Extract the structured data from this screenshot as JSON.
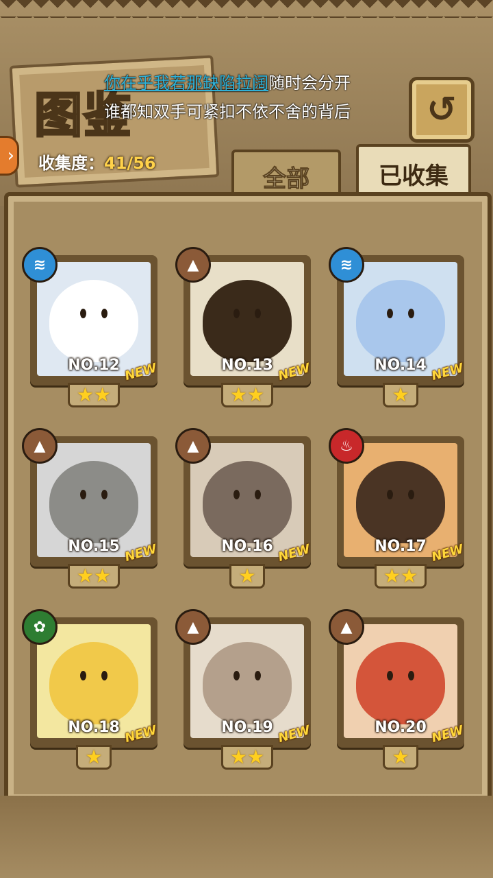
{
  "header": {
    "title": "图鉴",
    "lyric_highlight": "你在乎我若那缺陷拉阔",
    "lyric_rest": "随时会分开",
    "lyric_line2": "谁都知双手可紧扣不依不舍的背后",
    "collect_label": "收集度：",
    "collect_value": "41/56",
    "back_icon": "↺"
  },
  "tabs": {
    "all_label": "全部",
    "collected_label": "已收集"
  },
  "colors": {
    "water": "#2f8fd6",
    "earth": "#8b5a38",
    "fire": "#c8282a",
    "wood": "#2e7d32"
  },
  "cards": [
    {
      "number": "NO.12",
      "element": "water-icon",
      "element_glyph": "≋",
      "stars": "★★",
      "new_label": "NEW"
    },
    {
      "number": "NO.13",
      "element": "earth-icon",
      "element_glyph": "▲",
      "stars": "★★",
      "new_label": "NEW"
    },
    {
      "number": "NO.14",
      "element": "water-icon",
      "element_glyph": "≋",
      "stars": "★",
      "new_label": "NEW"
    },
    {
      "number": "NO.15",
      "element": "earth-icon",
      "element_glyph": "▲",
      "stars": "★★",
      "new_label": "NEW"
    },
    {
      "number": "NO.16",
      "element": "earth-icon",
      "element_glyph": "▲",
      "stars": "★",
      "new_label": "NEW"
    },
    {
      "number": "NO.17",
      "element": "fire-icon",
      "element_glyph": "♨",
      "stars": "★★",
      "new_label": "NEW"
    },
    {
      "number": "NO.18",
      "element": "wood-icon",
      "element_glyph": "✿",
      "stars": "★",
      "new_label": "NEW"
    },
    {
      "number": "NO.19",
      "element": "earth-icon",
      "element_glyph": "▲",
      "stars": "★★",
      "new_label": "NEW"
    },
    {
      "number": "NO.20",
      "element": "earth-icon",
      "element_glyph": "▲",
      "stars": "★",
      "new_label": "NEW"
    }
  ]
}
